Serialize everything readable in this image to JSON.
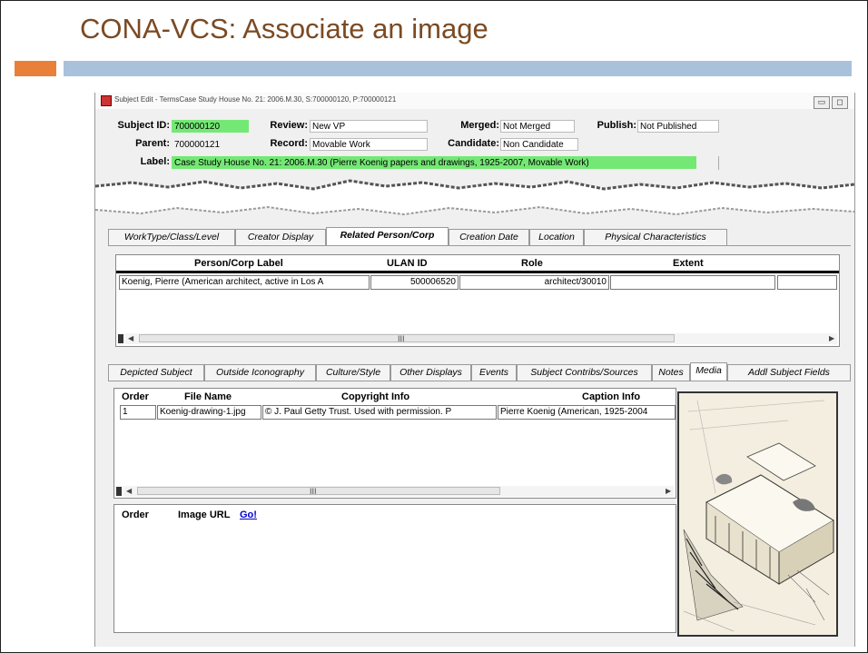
{
  "slide": {
    "title": "CONA-VCS: Associate an image",
    "colors": {
      "title": "#7b4a22",
      "accent_orange": "#e8803a",
      "accent_blue": "#a9c1db"
    }
  },
  "window": {
    "title": "Subject Edit - TermsCase Study House No. 21: 2006.M.30, S:700000120, P:700000121",
    "buttons": [
      "▭",
      "◻"
    ]
  },
  "header": {
    "subject_id_label": "Subject ID:",
    "subject_id": "700000120",
    "review_label": "Review:",
    "review": "New VP",
    "merged_label": "Merged:",
    "merged": "Not Merged",
    "publish_label": "Publish:",
    "publish": "Not Published",
    "parent_label": "Parent:",
    "parent": "700000121",
    "record_label": "Record:",
    "record": "Movable Work",
    "candidate_label": "Candidate:",
    "candidate": "Non Candidate",
    "label_label": "Label:",
    "label": "Case Study House No. 21: 2006.M.30  (Pierre Koenig papers and drawings, 1925-2007, Movable Work)"
  },
  "top_tabs": {
    "items": [
      "WorkType/Class/Level",
      "Creator Display",
      "Related Person/Corp",
      "Creation Date",
      "Location",
      "Physical Characteristics"
    ],
    "active": "Related Person/Corp"
  },
  "person_table": {
    "headers": [
      "Person/Corp Label",
      "ULAN ID",
      "Role",
      "Extent"
    ],
    "rows": [
      {
        "label": "Koenig, Pierre (American architect, active in Los A",
        "ulan": "500006520",
        "role": "architect/30010",
        "extent": ""
      }
    ],
    "scroll_mark": "III"
  },
  "bottom_tabs": {
    "items": [
      "Depicted Subject",
      "Outside Iconography",
      "Culture/Style",
      "Other Displays",
      "Events",
      "Subject Contribs/Sources",
      "Notes",
      "Media",
      "Addl Subject Fields"
    ],
    "active": "Media"
  },
  "media_table": {
    "headers": [
      "Order",
      "File Name",
      "Copyright Info",
      "Caption Info"
    ],
    "rows": [
      {
        "order": "1",
        "file": "Koenig-drawing-1.jpg",
        "copyright": "© J. Paul Getty Trust. Used with permission. P",
        "caption": "Pierre Koenig (American, 1925-2004"
      }
    ],
    "scroll_mark": "III"
  },
  "image_url": {
    "order_label": "Order",
    "url_label": "Image URL",
    "go_label": "Go!"
  }
}
